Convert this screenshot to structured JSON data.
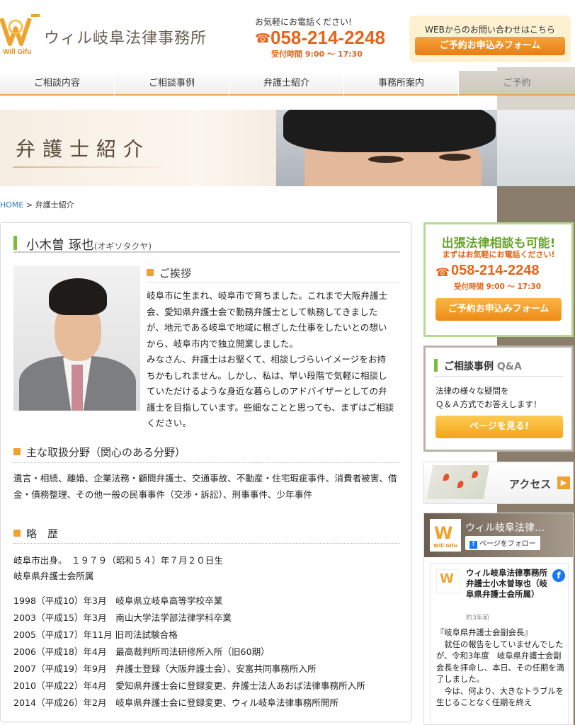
{
  "header": {
    "logo_sub": "Will Gifu",
    "site_title": "ウィル岐阜法律事務所",
    "tel_lead": "お気軽にお電話ください!",
    "tel_number": "058-214-2248",
    "tel_hours": "受付時間 9:00 ～ 17:30",
    "web_lead": "WEBからのお問い合わせはこちら",
    "web_button": "ご予約お申込みフォーム"
  },
  "nav": [
    {
      "label": "ご相談内容"
    },
    {
      "label": "ご相談事例"
    },
    {
      "label": "弁護士紹介"
    },
    {
      "label": "事務所案内"
    },
    {
      "label": "ご予約"
    }
  ],
  "hero": {
    "title": "弁護士紹介"
  },
  "breadcrumb": {
    "home": "HOME",
    "sep": " > ",
    "current": "弁護士紹介"
  },
  "profile": {
    "name": "小木曽 琢也",
    "kana": "(オギソタクヤ)",
    "greeting_title": "ご挨拶",
    "greeting_text": "岐阜市に生まれ、岐阜市で育ちました。これまで大阪弁護士会、愛知県弁護士会で勤務弁護士として執務してきましたが、地元である岐阜で地域に根ざした仕事をしたいとの想いから、岐阜市内で独立開業しました。\nみなさん、弁護士はお堅くて、相談しづらいイメージをお持ちかもしれません。しかし、私は、早い段階で気軽に相談していただけるような身近な暮らしのアドバイザーとしての弁護士を目指しています。些細なことと思っても、まずはご相談ください。",
    "fields_title": "主な取扱分野（関心のある分野）",
    "fields_text": "遺言・相続、離婚、企業法務・顧問弁護士、交通事故、不動産・住宅瑕疵事件、消費者被害、借金・債務整理、その他一般の民事事件（交渉・訴訟）、刑事事件、少年事件",
    "history_title": "略　歴",
    "born": "岐阜市出身。　１９７９（昭和５４）年７月２０日生",
    "association": "岐阜県弁護士会所属",
    "history": [
      "1998（平成10）年3月　岐阜県立岐阜高等学校卒業",
      "2003（平成15）年3月　南山大学法学部法律学科卒業",
      "2005（平成17）年11月 旧司法試験合格",
      "2006（平成18）年4月　最高裁判所司法研修所入所（旧60期）",
      "2007（平成19）年9月　弁護士登録（大阪弁護士会）、安富共同事務所入所",
      "2010（平成22）年4月　愛知県弁護士会に登録変更、弁護士法人あおば法律事務所入所",
      "2014（平成26）年2月　岐阜県弁護士会に登録変更、ウィル岐阜法律事務所開所"
    ]
  },
  "sidebar": {
    "tel_box": {
      "headline": "出張法律相談も可能!",
      "lead": "まずはお気軽にお電話ください!",
      "number": "058-214-2248",
      "hours": "受付時間 9:00 ～ 17:30",
      "button": "ご予約お申込みフォーム"
    },
    "qa_box": {
      "title": "ご相談事例",
      "title_suffix": "Q&A",
      "desc1": "法律の様々な疑問を",
      "desc2": "Ｑ＆Ａ方式でお答えします！",
      "button": "ページを見る!"
    },
    "access": {
      "label": "アクセス",
      "arrow": "▶"
    },
    "facebook": {
      "page_name": "ウィル岐阜法律…",
      "follow": "ページをフォロー",
      "post_author": "ウィル岐阜法律事務所　弁護士小木曽琢也（岐阜県弁護士会所属）",
      "post_time": "約3年前",
      "post_text": "『岐阜県弁護士会副会長』\n　就任の報告をしていませんでしたが、令和3年度　岐阜県弁護士会副会長を拝命し、本日、その任期を満了しました。\n　今は、何より、大きなトラブルを生じることなく任期を終え"
    }
  }
}
